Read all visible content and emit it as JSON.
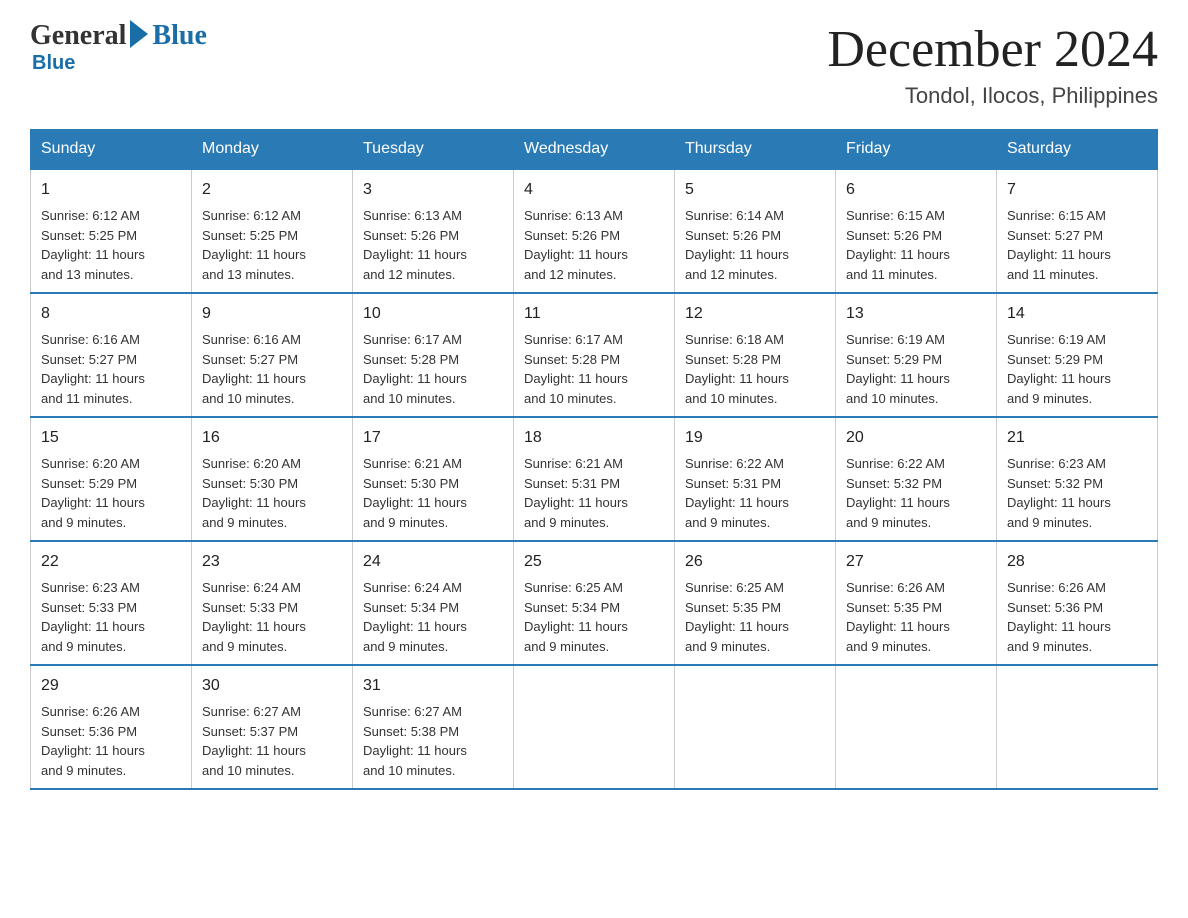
{
  "logo": {
    "general": "General",
    "blue": "Blue"
  },
  "title": "December 2024",
  "subtitle": "Tondol, Ilocos, Philippines",
  "days_of_week": [
    "Sunday",
    "Monday",
    "Tuesday",
    "Wednesday",
    "Thursday",
    "Friday",
    "Saturday"
  ],
  "weeks": [
    [
      {
        "day": "1",
        "sunrise": "6:12 AM",
        "sunset": "5:25 PM",
        "daylight": "11 hours and 13 minutes."
      },
      {
        "day": "2",
        "sunrise": "6:12 AM",
        "sunset": "5:25 PM",
        "daylight": "11 hours and 13 minutes."
      },
      {
        "day": "3",
        "sunrise": "6:13 AM",
        "sunset": "5:26 PM",
        "daylight": "11 hours and 12 minutes."
      },
      {
        "day": "4",
        "sunrise": "6:13 AM",
        "sunset": "5:26 PM",
        "daylight": "11 hours and 12 minutes."
      },
      {
        "day": "5",
        "sunrise": "6:14 AM",
        "sunset": "5:26 PM",
        "daylight": "11 hours and 12 minutes."
      },
      {
        "day": "6",
        "sunrise": "6:15 AM",
        "sunset": "5:26 PM",
        "daylight": "11 hours and 11 minutes."
      },
      {
        "day": "7",
        "sunrise": "6:15 AM",
        "sunset": "5:27 PM",
        "daylight": "11 hours and 11 minutes."
      }
    ],
    [
      {
        "day": "8",
        "sunrise": "6:16 AM",
        "sunset": "5:27 PM",
        "daylight": "11 hours and 11 minutes."
      },
      {
        "day": "9",
        "sunrise": "6:16 AM",
        "sunset": "5:27 PM",
        "daylight": "11 hours and 10 minutes."
      },
      {
        "day": "10",
        "sunrise": "6:17 AM",
        "sunset": "5:28 PM",
        "daylight": "11 hours and 10 minutes."
      },
      {
        "day": "11",
        "sunrise": "6:17 AM",
        "sunset": "5:28 PM",
        "daylight": "11 hours and 10 minutes."
      },
      {
        "day": "12",
        "sunrise": "6:18 AM",
        "sunset": "5:28 PM",
        "daylight": "11 hours and 10 minutes."
      },
      {
        "day": "13",
        "sunrise": "6:19 AM",
        "sunset": "5:29 PM",
        "daylight": "11 hours and 10 minutes."
      },
      {
        "day": "14",
        "sunrise": "6:19 AM",
        "sunset": "5:29 PM",
        "daylight": "11 hours and 9 minutes."
      }
    ],
    [
      {
        "day": "15",
        "sunrise": "6:20 AM",
        "sunset": "5:29 PM",
        "daylight": "11 hours and 9 minutes."
      },
      {
        "day": "16",
        "sunrise": "6:20 AM",
        "sunset": "5:30 PM",
        "daylight": "11 hours and 9 minutes."
      },
      {
        "day": "17",
        "sunrise": "6:21 AM",
        "sunset": "5:30 PM",
        "daylight": "11 hours and 9 minutes."
      },
      {
        "day": "18",
        "sunrise": "6:21 AM",
        "sunset": "5:31 PM",
        "daylight": "11 hours and 9 minutes."
      },
      {
        "day": "19",
        "sunrise": "6:22 AM",
        "sunset": "5:31 PM",
        "daylight": "11 hours and 9 minutes."
      },
      {
        "day": "20",
        "sunrise": "6:22 AM",
        "sunset": "5:32 PM",
        "daylight": "11 hours and 9 minutes."
      },
      {
        "day": "21",
        "sunrise": "6:23 AM",
        "sunset": "5:32 PM",
        "daylight": "11 hours and 9 minutes."
      }
    ],
    [
      {
        "day": "22",
        "sunrise": "6:23 AM",
        "sunset": "5:33 PM",
        "daylight": "11 hours and 9 minutes."
      },
      {
        "day": "23",
        "sunrise": "6:24 AM",
        "sunset": "5:33 PM",
        "daylight": "11 hours and 9 minutes."
      },
      {
        "day": "24",
        "sunrise": "6:24 AM",
        "sunset": "5:34 PM",
        "daylight": "11 hours and 9 minutes."
      },
      {
        "day": "25",
        "sunrise": "6:25 AM",
        "sunset": "5:34 PM",
        "daylight": "11 hours and 9 minutes."
      },
      {
        "day": "26",
        "sunrise": "6:25 AM",
        "sunset": "5:35 PM",
        "daylight": "11 hours and 9 minutes."
      },
      {
        "day": "27",
        "sunrise": "6:26 AM",
        "sunset": "5:35 PM",
        "daylight": "11 hours and 9 minutes."
      },
      {
        "day": "28",
        "sunrise": "6:26 AM",
        "sunset": "5:36 PM",
        "daylight": "11 hours and 9 minutes."
      }
    ],
    [
      {
        "day": "29",
        "sunrise": "6:26 AM",
        "sunset": "5:36 PM",
        "daylight": "11 hours and 9 minutes."
      },
      {
        "day": "30",
        "sunrise": "6:27 AM",
        "sunset": "5:37 PM",
        "daylight": "11 hours and 10 minutes."
      },
      {
        "day": "31",
        "sunrise": "6:27 AM",
        "sunset": "5:38 PM",
        "daylight": "11 hours and 10 minutes."
      },
      null,
      null,
      null,
      null
    ]
  ],
  "labels": {
    "sunrise": "Sunrise:",
    "sunset": "Sunset:",
    "daylight": "Daylight:"
  }
}
